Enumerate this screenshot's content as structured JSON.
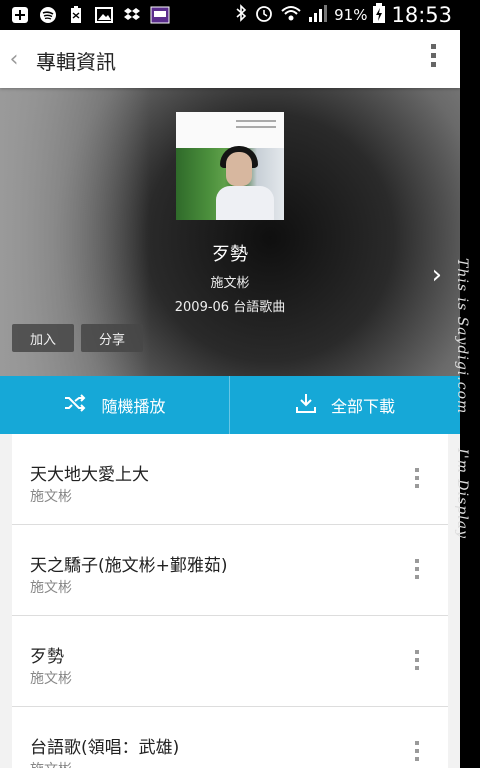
{
  "status_bar": {
    "battery": "91%",
    "time": "18:53"
  },
  "header": {
    "title": "專輯資訊"
  },
  "album": {
    "title": "歹勢",
    "artist": "施文彬",
    "meta": "2009-06 台語歌曲",
    "add_label": "加入",
    "share_label": "分享"
  },
  "actions": {
    "shuffle_label": "隨機播放",
    "download_label": "全部下載"
  },
  "tracks": [
    {
      "title": "天大地大愛上大",
      "artist": "施文彬"
    },
    {
      "title": "天之驕子(施文彬+鄞雅茹)",
      "artist": "施文彬"
    },
    {
      "title": "歹勢",
      "artist": "施文彬"
    },
    {
      "title": "台語歌(領唱：武雄)",
      "artist": "施文彬"
    }
  ],
  "watermark": {
    "line1": "This is Saydigi.com",
    "line2": "I'm Display"
  },
  "colors": {
    "accent": "#16a8d7"
  }
}
